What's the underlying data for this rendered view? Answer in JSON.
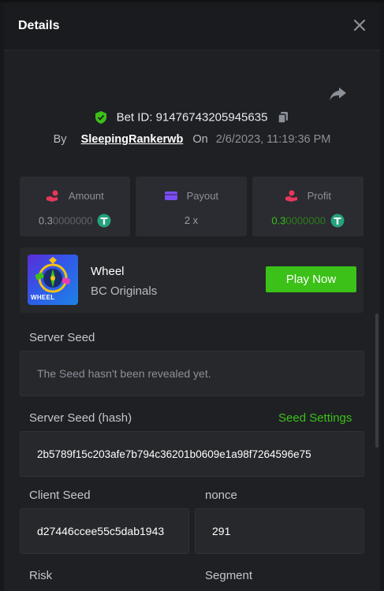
{
  "header": {
    "title": "Details"
  },
  "bet": {
    "id_label": "Bet ID:",
    "id_value": "91476743205945635",
    "by_label": "By",
    "username": "SleepingRankerwb",
    "on_label": "On",
    "date": "2/6/2023, 11:19:36 PM"
  },
  "stats": {
    "amount": {
      "label": "Amount",
      "value_lead": "0.3",
      "value_tail": "0000000"
    },
    "payout": {
      "label": "Payout",
      "value": "2 x"
    },
    "profit": {
      "label": "Profit",
      "value_lead": "0.3",
      "value_tail": "0000000"
    }
  },
  "game": {
    "name": "Wheel",
    "provider": "BC Originals",
    "thumb_text": "WHEEL",
    "play_label": "Play Now"
  },
  "fairness": {
    "server_seed_label": "Server Seed",
    "server_seed_value": "The Seed hasn't been revealed yet.",
    "server_hash_label": "Server Seed (hash)",
    "seed_settings_label": "Seed Settings",
    "server_hash_value": "2b5789f15c203afe7b794c36201b0609e1a98f7264596e75",
    "client_seed_label": "Client Seed",
    "client_seed_value": "d27446ccee55c5dab1943",
    "nonce_label": "nonce",
    "nonce_value": "291",
    "risk_label": "Risk",
    "segment_label": "Segment"
  },
  "colors": {
    "accent_green": "#3bc117",
    "background": "#1f2024",
    "panel": "#26282c"
  },
  "icons": {
    "close": "close-icon",
    "share": "share-icon",
    "verified": "shield-check-icon",
    "copy": "copy-icon",
    "amount": "hand-coin-icon",
    "payout": "wallet-icon",
    "profit": "profit-hand-icon",
    "currency": "tether-icon"
  }
}
